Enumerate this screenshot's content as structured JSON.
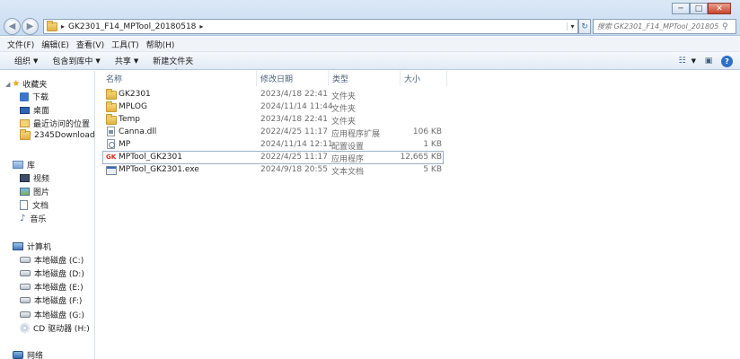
{
  "window": {
    "minimize": "─",
    "maximize": "□",
    "close": "✕"
  },
  "nav": {
    "back": "◀",
    "forward": "▶"
  },
  "address": {
    "path": "GK2301_F14_MPTool_20180518",
    "separator_before": "▸",
    "separator_after": "▸",
    "dropdown": "▾",
    "refresh": "↻"
  },
  "search": {
    "placeholder": "搜索 GK2301_F14_MPTool_201805..."
  },
  "menubar": [
    "文件(F)",
    "编辑(E)",
    "查看(V)",
    "工具(T)",
    "帮助(H)"
  ],
  "toolbar": {
    "organize": "组织",
    "include_in_library": "包含到库中",
    "share": "共享",
    "new_folder": "新建文件夹",
    "help": "?"
  },
  "sidebar": {
    "favorites": "收藏夹",
    "downloads": "下载",
    "desktop": "桌面",
    "recent": "最近访问的位置",
    "downloads2345": "2345Downloads",
    "libraries": "库",
    "videos": "视频",
    "pictures": "图片",
    "documents": "文档",
    "music": "音乐",
    "computer": "计算机",
    "drive_c": "本地磁盘 (C:)",
    "drive_d": "本地磁盘 (D:)",
    "drive_e": "本地磁盘 (E:)",
    "drive_f": "本地磁盘 (F:)",
    "drive_g": "本地磁盘 (G:)",
    "drive_h": "CD 驱动器 (H:)",
    "network": "网络"
  },
  "columns": {
    "name": "名称",
    "date": "修改日期",
    "type": "类型",
    "size": "大小"
  },
  "files": [
    {
      "name": "GK2301",
      "date": "2023/4/18 22:41",
      "type": "文件夹",
      "size": ""
    },
    {
      "name": "MPLOG",
      "date": "2024/11/14 11:44",
      "type": "文件夹",
      "size": ""
    },
    {
      "name": "Temp",
      "date": "2023/4/18 22:41",
      "type": "文件夹",
      "size": ""
    },
    {
      "name": "Canna.dll",
      "date": "2022/4/25 11:17",
      "type": "应用程序扩展",
      "size": "106 KB"
    },
    {
      "name": "MP",
      "date": "2024/11/14 12:11",
      "type": "配置设置",
      "size": "1 KB"
    },
    {
      "name": "MPTool_GK2301",
      "date": "2022/4/25 11:17",
      "type": "应用程序",
      "size": "12,665 KB"
    },
    {
      "name": "MPTool_GK2301.exe",
      "date": "2024/9/18 20:55",
      "type": "文本文档",
      "size": "5 KB"
    }
  ],
  "icon_text": {
    "gk": "GK",
    "star": "★",
    "music": "♪",
    "search": "⚲",
    "view": "☷",
    "pane": "▣"
  }
}
